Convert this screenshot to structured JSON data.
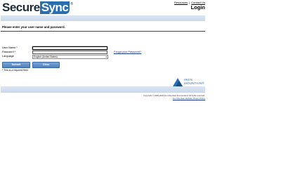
{
  "header": {
    "logo_part1": "Secure",
    "logo_part2": "Sync",
    "logo_tm": "®",
    "links": [
      "Resources",
      "Contact Us"
    ],
    "link_separator": "|",
    "title": "Login"
  },
  "instructions": "Please enter your user name and password.",
  "form": {
    "username_label": "User Name *",
    "password_label": "Password *",
    "language_label": "Language",
    "username_value": "",
    "password_value": "",
    "language_value": "English (United States)",
    "forgot_password": "Forgot your Password?",
    "submit_label": "Submit",
    "clear_label": "Clear",
    "required_note": "* This is a required field."
  },
  "brand": {
    "name_line1": "IRON",
    "name_line2": "MOUNTAIN®",
    "color": "#2c6fb0"
  },
  "footer": {
    "copyright": "Copyright © 1999-2022 Iron Mountain Incorporated. All rights reserved.",
    "links_text": "Iron Mountain Website Privacy Policy"
  }
}
